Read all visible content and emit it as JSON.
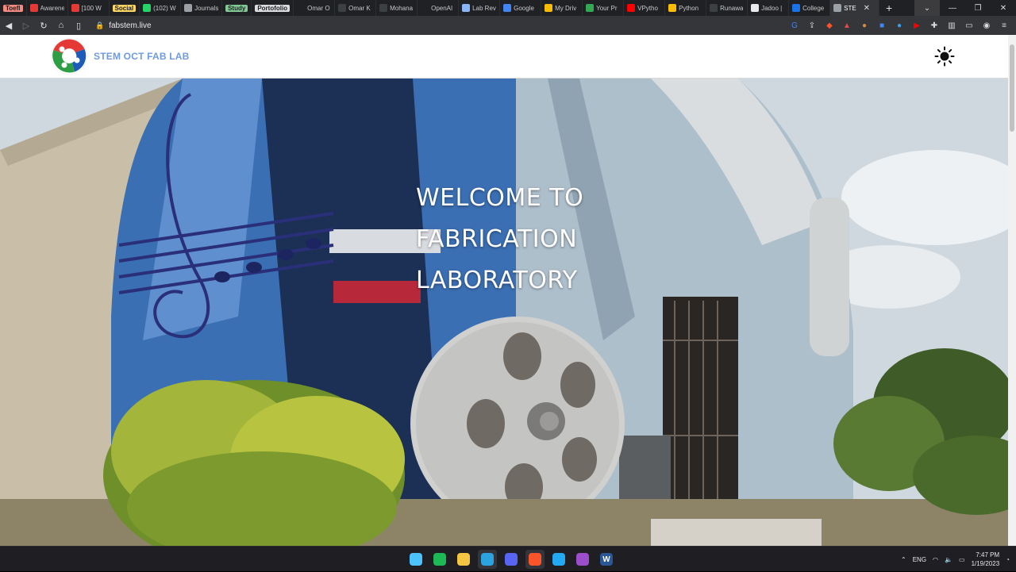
{
  "browser": {
    "tabs": [
      {
        "label": "Toefl",
        "icon": "bookmark-folder-icon",
        "color": "#f28b82",
        "labeled": true
      },
      {
        "label": "Awarene",
        "icon": "vivaldi-icon",
        "color": "#e53935"
      },
      {
        "label": "[100 W",
        "icon": "vivaldi-icon",
        "color": "#e53935"
      },
      {
        "label": "Social",
        "icon": "bookmark-folder-icon",
        "color": "#fdd663",
        "labeled": true
      },
      {
        "label": "(102) W",
        "icon": "whatsapp-icon",
        "color": "#25d366"
      },
      {
        "label": "Journals",
        "icon": "page-icon",
        "color": "#9aa0a6"
      },
      {
        "label": "Study",
        "icon": "bookmark-folder-icon",
        "color": "#81c995",
        "labeled": true
      },
      {
        "label": "Portofolio",
        "icon": "bookmark-folder-icon",
        "color": "#dadce0",
        "labeled": true
      },
      {
        "label": "Omar O",
        "icon": "github-icon",
        "color": "#202124"
      },
      {
        "label": "Omar K",
        "icon": "site-icon",
        "color": "#3c4043"
      },
      {
        "label": "Mohana",
        "icon": "site-icon",
        "color": "#3c4043"
      },
      {
        "label": "OpenAI",
        "icon": "openai-icon",
        "color": "#202124"
      },
      {
        "label": "Lab Rev",
        "icon": "docs-icon",
        "color": "#8ab4f8"
      },
      {
        "label": "Google",
        "icon": "translate-icon",
        "color": "#4285f4"
      },
      {
        "label": "My Driv",
        "icon": "drive-icon",
        "color": "#fbbc04"
      },
      {
        "label": "Your Pr",
        "icon": "repl-icon",
        "color": "#34a853"
      },
      {
        "label": "VPytho",
        "icon": "youtube-icon",
        "color": "#ff0000"
      },
      {
        "label": "Python",
        "icon": "drive-icon",
        "color": "#fbbc04"
      },
      {
        "label": "Runawa",
        "icon": "site-icon",
        "color": "#3c4043"
      },
      {
        "label": "Jadoo |",
        "icon": "site-icon",
        "color": "#e8eaed"
      },
      {
        "label": "College",
        "icon": "site-icon",
        "color": "#1a73e8"
      },
      {
        "label": "STE",
        "icon": "globe-icon",
        "color": "#9aa0a6",
        "active": true
      }
    ],
    "new_tab": "+",
    "url": "fabstem.live"
  },
  "site": {
    "brand": "STEM OCT FAB LAB",
    "hero": {
      "line1": "WELCOME TO",
      "line2": "FABRICATION",
      "line3": "LABORATORY"
    }
  },
  "taskbar": {
    "apps": [
      {
        "name": "windows-start-icon",
        "glyph": "",
        "color": "#4cc2ff"
      },
      {
        "name": "spotify-icon",
        "glyph": "",
        "color": "#1db954"
      },
      {
        "name": "file-explorer-icon",
        "glyph": "",
        "color": "#f4c542"
      },
      {
        "name": "telegram-icon",
        "glyph": "",
        "color": "#2aa3e0",
        "active": true
      },
      {
        "name": "discord-icon",
        "glyph": "",
        "color": "#5865f2"
      },
      {
        "name": "brave-icon",
        "glyph": "",
        "color": "#fb542b",
        "active": true
      },
      {
        "name": "vscode-icon",
        "glyph": "",
        "color": "#23a9f2"
      },
      {
        "name": "github-desktop-icon",
        "glyph": "",
        "color": "#9b4dca"
      },
      {
        "name": "word-icon",
        "glyph": "W",
        "color": "#2b5797"
      }
    ],
    "lang": "ENG",
    "time": "7:47 PM",
    "date": "1/19/2023"
  },
  "colors": {
    "brand": "#6f9bde",
    "tab_strip": "#202124",
    "toolbar": "#35363a",
    "taskbar": "#1f1f23"
  }
}
